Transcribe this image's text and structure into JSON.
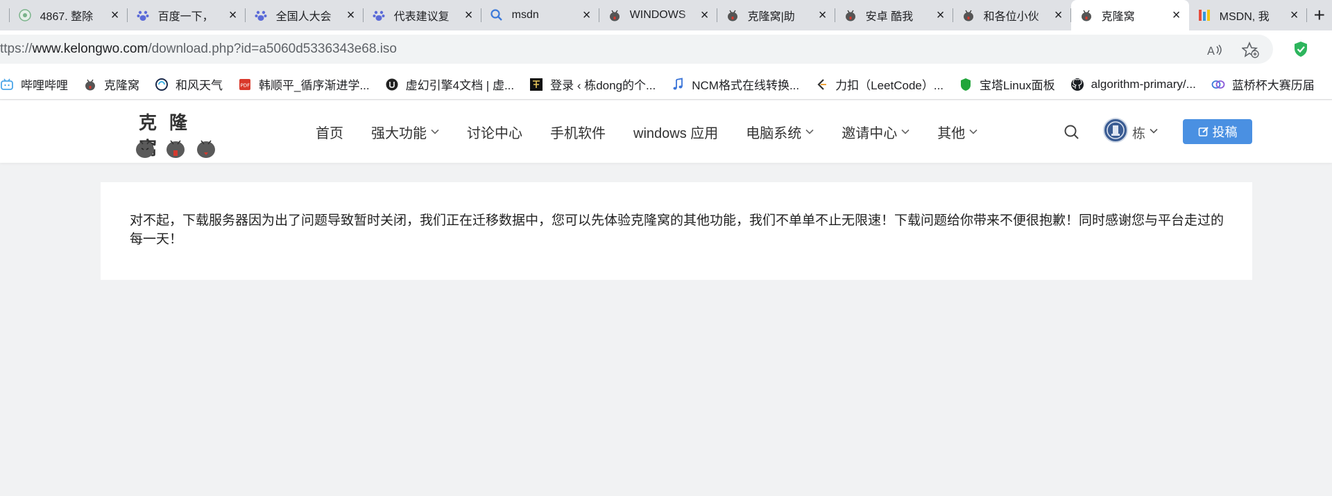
{
  "tabs": [
    {
      "title": "4867. 整除",
      "icon": "circle-green-icon"
    },
    {
      "title": "百度一下，",
      "icon": "baidu-paw-icon"
    },
    {
      "title": "全国人大会",
      "icon": "baidu-paw-icon"
    },
    {
      "title": "代表建议复",
      "icon": "baidu-paw-icon"
    },
    {
      "title": "msdn",
      "icon": "search-icon"
    },
    {
      "title": "WINDOWS",
      "icon": "bug-icon"
    },
    {
      "title": "克隆窝|助",
      "icon": "bug-icon"
    },
    {
      "title": "安卓 酷我",
      "icon": "bug-icon"
    },
    {
      "title": "和各位小伙",
      "icon": "bug-icon"
    },
    {
      "title": "克隆窝",
      "icon": "bug-icon",
      "active": true
    },
    {
      "title": "MSDN, 我",
      "icon": "msdn-icon"
    }
  ],
  "address": {
    "prefix": "ttps://",
    "host": "www.kelongwo.com",
    "path": "/download.php?id=a5060d5336343e68.iso"
  },
  "bookmarks": [
    {
      "label": "哔哩哔哩",
      "icon": "bilibili-icon"
    },
    {
      "label": "克隆窝",
      "icon": "bug-icon"
    },
    {
      "label": "和风天气",
      "icon": "qweather-icon"
    },
    {
      "label": "韩顺平_循序渐进学...",
      "icon": "pdf-icon"
    },
    {
      "label": "虚幻引擎4文档 | 虚...",
      "icon": "unreal-icon"
    },
    {
      "label": "登录 ‹ 栋dong的个...",
      "icon": "dong-icon"
    },
    {
      "label": "NCM格式在线转换...",
      "icon": "music-note-icon"
    },
    {
      "label": "力扣（LeetCode）...",
      "icon": "leetcode-icon"
    },
    {
      "label": "宝塔Linux面板",
      "icon": "baota-icon"
    },
    {
      "label": "algorithm-primary/...",
      "icon": "github-icon"
    },
    {
      "label": "蓝桥杯大赛历届",
      "icon": "lanqiao-icon"
    }
  ],
  "site": {
    "logo_text": "克隆窝",
    "nav": [
      {
        "label": "首页",
        "dropdown": false
      },
      {
        "label": "强大功能",
        "dropdown": true
      },
      {
        "label": "讨论中心",
        "dropdown": false
      },
      {
        "label": "手机软件",
        "dropdown": false
      },
      {
        "label": "windows 应用",
        "dropdown": false
      },
      {
        "label": "电脑系统",
        "dropdown": true
      },
      {
        "label": "邀请中心",
        "dropdown": true
      },
      {
        "label": "其他",
        "dropdown": true
      }
    ],
    "user_name": "栋",
    "post_label": "投稿"
  },
  "notice": "对不起，下载服务器因为出了问题导致暂时关闭，我们正在迁移数据中，您可以先体验克隆窝的其他功能，我们不单单不止无限速！下载问题给你带来不便很抱歉！同时感谢您与平台走过的每一天！",
  "colors": {
    "accent": "#4a90e2",
    "page_bg": "#f1f2f3",
    "tab_strip": "#dfe1e5"
  }
}
